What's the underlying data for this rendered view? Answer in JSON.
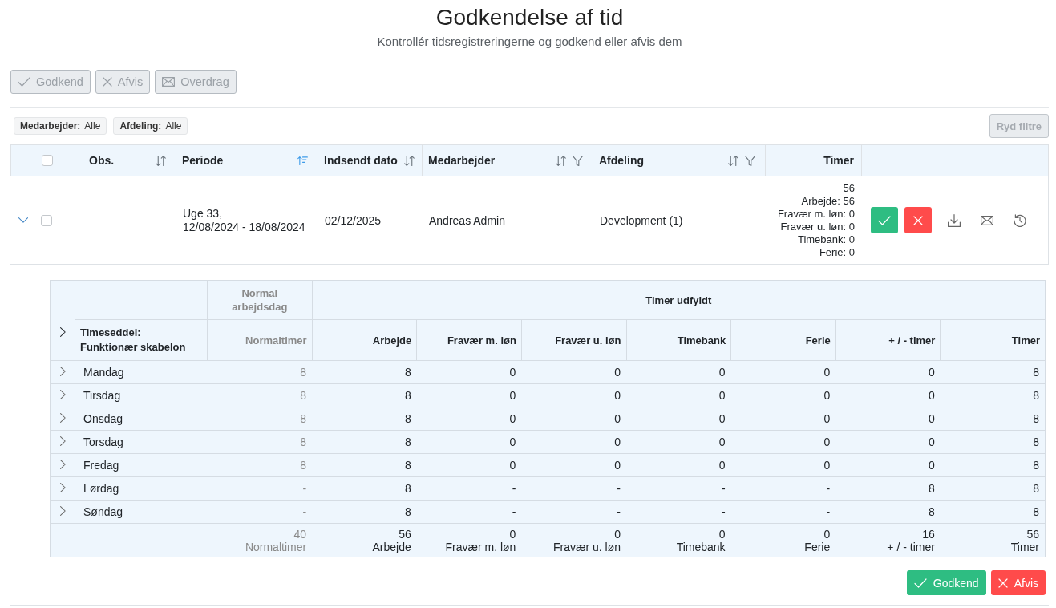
{
  "header": {
    "title": "Godkendelse af tid",
    "subtitle": "Kontrollér tidsregistreringerne og godkend eller afvis dem"
  },
  "toolbar": [
    {
      "kind": "approve",
      "label": "Godkend",
      "disabled": true
    },
    {
      "kind": "reject",
      "label": "Afvis",
      "disabled": true
    },
    {
      "kind": "forward",
      "label": "Overdrag",
      "disabled": true
    }
  ],
  "filters": [
    {
      "label": "Medarbejder:",
      "value": "Alle"
    },
    {
      "label": "Afdeling:",
      "value": "Alle"
    }
  ],
  "clear_filters": {
    "label": "Ryd filtre",
    "disabled": true
  },
  "table": {
    "select_all": {
      "checked": false
    },
    "columns": [
      {
        "label": "Obs.",
        "sortable": true,
        "sorted": false,
        "filter": false
      },
      {
        "label": "Periode",
        "sortable": true,
        "sorted": true,
        "filter": false
      },
      {
        "label": "Indsendt dato",
        "sortable": true,
        "sorted": false,
        "filter": false
      },
      {
        "label": "Medarbejder",
        "sortable": true,
        "sorted": false,
        "filter": true
      },
      {
        "label": "Afdeling",
        "sortable": true,
        "sorted": false,
        "filter": true
      },
      {
        "label": "Timer",
        "sortable": false,
        "filter": false
      }
    ],
    "rows": [
      {
        "expanded": true,
        "checked": false,
        "period": [
          "Uge 33,",
          "12/08/2024 - 18/08/2024"
        ],
        "submitted": "02/12/2025",
        "employee": "Andreas Admin",
        "department": "Development (1)",
        "hours": [
          "56",
          "Arbejde: 56",
          "Fravær m. løn: 0",
          "Fravær u. løn: 0",
          "Timebank: 0",
          "Ferie: 0"
        ],
        "actions": [
          {
            "kind": "approve"
          },
          {
            "kind": "reject"
          },
          {
            "kind": "download"
          },
          {
            "kind": "email"
          },
          {
            "kind": "history"
          }
        ],
        "timesheet": {
          "expanded": false,
          "title": [
            "Timeseddel:",
            "Funktionær skabelon"
          ],
          "column_groups": [
            {
              "label": "Normal arbejdsdag",
              "dimmed": true,
              "columns": [
                {
                  "label": "Normaltimer",
                  "dimmed": true
                }
              ]
            },
            {
              "label": "Timer udfyldt",
              "dimmed": false,
              "columns": [
                {
                  "label": "Arbejde",
                  "dimmed": false
                },
                {
                  "label": "Fravær m. løn",
                  "dimmed": false
                },
                {
                  "label": "Fravær u. løn",
                  "dimmed": false
                },
                {
                  "label": "Timebank",
                  "dimmed": false
                },
                {
                  "label": "Ferie",
                  "dimmed": false
                },
                {
                  "label": "+ / - timer",
                  "dimmed": false
                },
                {
                  "label": "Timer",
                  "dimmed": false
                }
              ]
            }
          ],
          "days": [
            {
              "name": "Mandag",
              "expanded": false,
              "values": [
                "8",
                "8",
                "0",
                "0",
                "0",
                "0",
                "0",
                "8"
              ]
            },
            {
              "name": "Tirsdag",
              "expanded": false,
              "values": [
                "8",
                "8",
                "0",
                "0",
                "0",
                "0",
                "0",
                "8"
              ]
            },
            {
              "name": "Onsdag",
              "expanded": false,
              "values": [
                "8",
                "8",
                "0",
                "0",
                "0",
                "0",
                "0",
                "8"
              ]
            },
            {
              "name": "Torsdag",
              "expanded": false,
              "values": [
                "8",
                "8",
                "0",
                "0",
                "0",
                "0",
                "0",
                "8"
              ]
            },
            {
              "name": "Fredag",
              "expanded": false,
              "values": [
                "8",
                "8",
                "0",
                "0",
                "0",
                "0",
                "0",
                "8"
              ]
            },
            {
              "name": "Lørdag",
              "expanded": false,
              "values": [
                "-",
                "8",
                "-",
                "-",
                "-",
                "-",
                "8",
                "8"
              ]
            },
            {
              "name": "Søndag",
              "expanded": false,
              "values": [
                "-",
                "8",
                "-",
                "-",
                "-",
                "-",
                "8",
                "8"
              ]
            }
          ],
          "totals": [
            {
              "value": "40",
              "label": "Normaltimer"
            },
            {
              "value": "56",
              "label": "Arbejde"
            },
            {
              "value": "0",
              "label": "Fravær m. løn"
            },
            {
              "value": "0",
              "label": "Fravær u. løn"
            },
            {
              "value": "0",
              "label": "Timebank"
            },
            {
              "value": "0",
              "label": "Ferie"
            },
            {
              "value": "16",
              "label": "+ / - timer"
            },
            {
              "value": "56",
              "label": "Timer"
            }
          ]
        },
        "detail_actions": [
          {
            "kind": "approve",
            "label": "Godkend"
          },
          {
            "kind": "reject",
            "label": "Afvis"
          }
        ]
      }
    ]
  }
}
